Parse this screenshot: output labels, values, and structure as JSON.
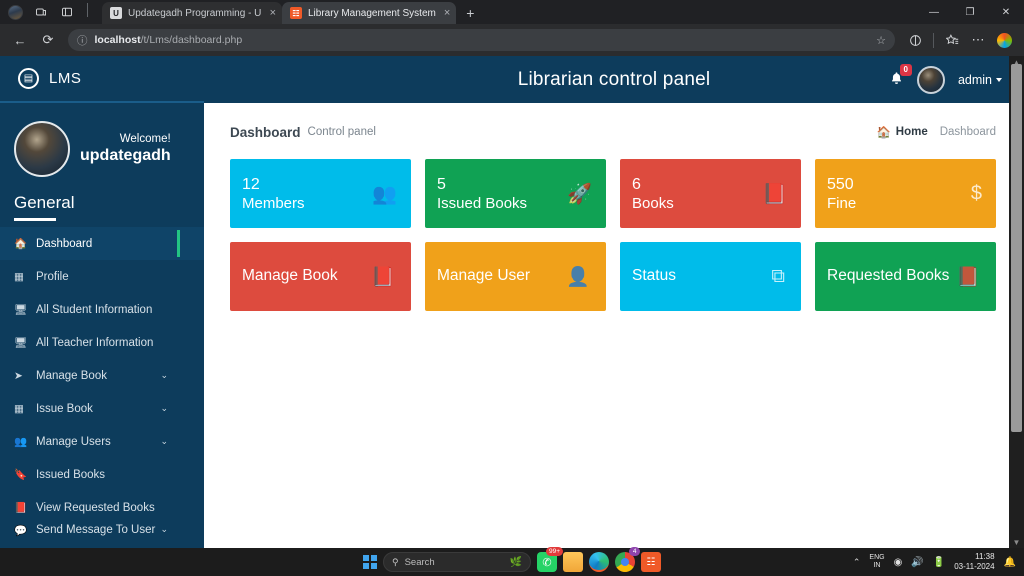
{
  "browser": {
    "tabs": [
      {
        "title": "Updategadh Programming - Upd",
        "favicon": "updategadh-favicon",
        "active": false,
        "close": "×"
      },
      {
        "title": "Library Management System",
        "favicon": "lms-favicon",
        "active": true,
        "close": "×"
      }
    ],
    "new_tab_label": "+",
    "window_controls": {
      "minimize": "—",
      "maximize": "❐",
      "close": "✕"
    },
    "toolbar": {
      "back": "←",
      "reload": "⟳",
      "info_icon": "ⓘ",
      "url_host": "localhost",
      "url_path": "/t/Lms/dashboard.php",
      "star": "☆",
      "split_screen": "◔",
      "favorites": "☆",
      "more": "⋯",
      "copilot": "copilot-icon"
    }
  },
  "app": {
    "brand": {
      "mark": "▤",
      "name": "LMS"
    },
    "title": "Librarian control panel",
    "notifications": {
      "icon": "bell-icon",
      "count": "0"
    },
    "user": {
      "name": "admin",
      "avatar": "admin-avatar"
    }
  },
  "sidebar": {
    "welcome_label": "Welcome!",
    "username": "updategadh",
    "section_title": "General",
    "items": [
      {
        "label": "Dashboard",
        "icon": "home-icon",
        "active": true,
        "expandable": false
      },
      {
        "label": "Profile",
        "icon": "id-card-icon",
        "active": false,
        "expandable": false
      },
      {
        "label": "All Student Information",
        "icon": "desktop-icon",
        "active": false,
        "expandable": false
      },
      {
        "label": "All Teacher Information",
        "icon": "desktop-icon",
        "active": false,
        "expandable": false
      },
      {
        "label": "Manage Book",
        "icon": "paper-plane-icon",
        "active": false,
        "expandable": true
      },
      {
        "label": "Issue Book",
        "icon": "id-card-icon",
        "active": false,
        "expandable": true
      },
      {
        "label": "Manage Users",
        "icon": "users-icon",
        "active": false,
        "expandable": true
      },
      {
        "label": "Issued Books",
        "icon": "bookmark-icon",
        "active": false,
        "expandable": false
      },
      {
        "label": "View Requested Books",
        "icon": "book-icon",
        "active": false,
        "expandable": false
      },
      {
        "label": "Send Message To User",
        "icon": "comments-icon",
        "active": false,
        "expandable": true
      }
    ],
    "chevron": "⌄"
  },
  "breadcrumb": {
    "title": "Dashboard",
    "subtitle": "Control panel",
    "home_icon": "home-icon",
    "home": "Home",
    "current": "Dashboard"
  },
  "stat_cards": [
    {
      "value": "12",
      "label": "Members",
      "icon": "users-icon",
      "glyph": "👥",
      "color": "#00bcea"
    },
    {
      "value": "5",
      "label": "Issued Books",
      "icon": "rocket-icon",
      "glyph": "🚀",
      "color": "#10a254"
    },
    {
      "value": "6",
      "label": "Books",
      "icon": "book-icon",
      "glyph": "📕",
      "color": "#dd4b3e"
    },
    {
      "value": "550",
      "label": "Fine",
      "icon": "dollar-icon",
      "glyph": "$",
      "color": "#f0a11a"
    }
  ],
  "action_cards": [
    {
      "label": "Manage Book",
      "icon": "book-icon",
      "glyph": "📕",
      "color": "#dd4b3e"
    },
    {
      "label": "Manage User",
      "icon": "user-icon",
      "glyph": "👤",
      "color": "#f0a11a"
    },
    {
      "label": "Status",
      "icon": "layers-icon",
      "glyph": "⧉",
      "color": "#00bcea"
    },
    {
      "label": "Requested Books",
      "icon": "book-icon",
      "glyph": "📕",
      "color": "#10a254"
    }
  ],
  "taskbar": {
    "start": "start-icon",
    "search_placeholder": "Search",
    "search_icon": "search-icon",
    "weather_icon": "weather-icon",
    "apps": [
      {
        "name": "whatsapp-icon",
        "badge": "99+"
      },
      {
        "name": "file-explorer-icon",
        "badge": ""
      },
      {
        "name": "edge-icon",
        "badge": ""
      },
      {
        "name": "chrome-icon",
        "badge": "4"
      },
      {
        "name": "xampp-icon",
        "badge": ""
      }
    ],
    "tray": {
      "chevron": "⌃",
      "language_top": "ENG",
      "language_bottom": "IN",
      "wifi": "wifi-icon",
      "volume": "volume-icon",
      "battery": "battery-icon",
      "time": "11:38",
      "date": "03-11-2024",
      "notification": "notification-bell-icon"
    }
  }
}
